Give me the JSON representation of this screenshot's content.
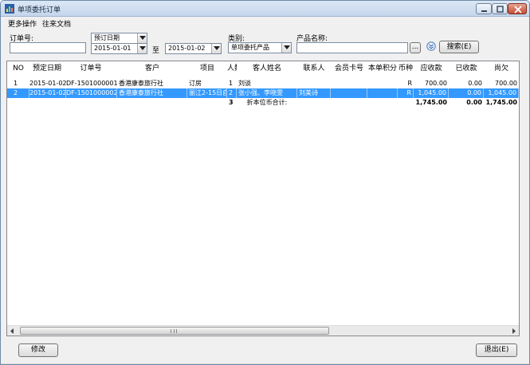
{
  "window": {
    "title": "单项委托订单"
  },
  "menu": {
    "items": [
      "更多操作",
      "往来文档"
    ]
  },
  "filters": {
    "order_no_label": "订单号:",
    "order_no_value": "",
    "date_type_value": "预订日期",
    "date_from": "2015-01-01",
    "to_label": "至",
    "date_to": "2015-01-02",
    "category_label": "类别:",
    "category_value": "单项委托产品",
    "product_label": "产品名称:",
    "product_value": "",
    "browse_label": "...",
    "search_label": "搜索(E)"
  },
  "grid": {
    "columns": [
      "NO",
      "预定日期",
      "订单号",
      "客户",
      "项目",
      "人数",
      "客人姓名",
      "联系人",
      "会员卡号",
      "本单积分",
      "币种",
      "应收款",
      "已收款",
      "尚欠"
    ],
    "rows": [
      {
        "no": "1",
        "date": "2015-01-02",
        "order": "DF-1501000001",
        "customer": "香港康泰旅行社",
        "project": "订房",
        "people": "1",
        "guest": "刘谈",
        "contact": "",
        "card": "",
        "points": "",
        "currency": "R",
        "receivable": "700.00",
        "received": "0.00",
        "owed": "700.00"
      },
      {
        "no": "2",
        "date": "2015-01-02",
        "order": "DF-1501000002",
        "customer": "香港康泰旅行社",
        "project": "丽江2-15日自",
        "people": "2",
        "guest": "张小强、李晓雯",
        "contact": "刘美诗",
        "card": "",
        "points": "",
        "currency": "R",
        "receivable": "1,045.00",
        "received": "0.00",
        "owed": "1,045.00"
      }
    ],
    "total": {
      "people": "3",
      "label": "折本位币合计:",
      "receivable": "1,745.00",
      "received": "0.00",
      "owed": "1,745.00"
    }
  },
  "footer": {
    "edit_label": "修改",
    "exit_label": "退出(E)"
  },
  "colors": {
    "selection": "#3399ff",
    "titlebar": "#c4d6ec"
  }
}
